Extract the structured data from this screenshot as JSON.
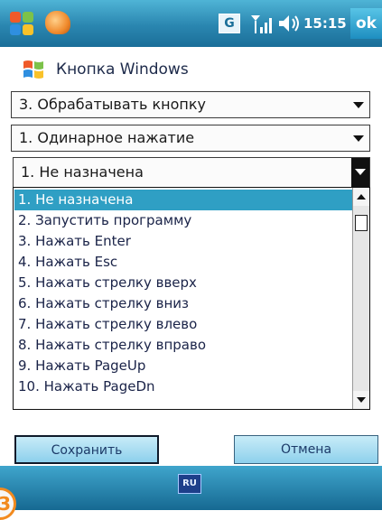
{
  "status_bar": {
    "time": "15:15",
    "ok_label": "ok",
    "g_icon_label": "G",
    "icons": [
      "windows-start-icon",
      "app-icon",
      "g-notification-icon",
      "signal-icon",
      "volume-icon"
    ]
  },
  "header": {
    "title": "Кнопка Windows",
    "icon": "windows-flag-icon"
  },
  "dropdowns": {
    "action": "3. Обрабатывать кнопку",
    "press_type": "1. Одинарное нажатие",
    "assignment": "1. Не назначена"
  },
  "options": [
    "1. Не назначена",
    "2. Запустить программу",
    "3. Нажать Enter",
    "4. Нажать Esc",
    "5. Нажать стрелку вверх",
    "6. Нажать стрелку вниз",
    "7. Нажать стрелку влево",
    "8. Нажать стрелку вправо",
    "9. Нажать PageUp",
    "10. Нажать PageDn"
  ],
  "selected_index": 0,
  "buttons": {
    "save": "Сохранить",
    "cancel": "Отмена"
  },
  "bottom_bar": {
    "input_label": "RU"
  },
  "corner_badge": "3",
  "colors": {
    "titlebar": "#2a86b0",
    "selection": "#2f9fc4",
    "button": "#a6dcf2",
    "badge": "#f28a1e"
  }
}
